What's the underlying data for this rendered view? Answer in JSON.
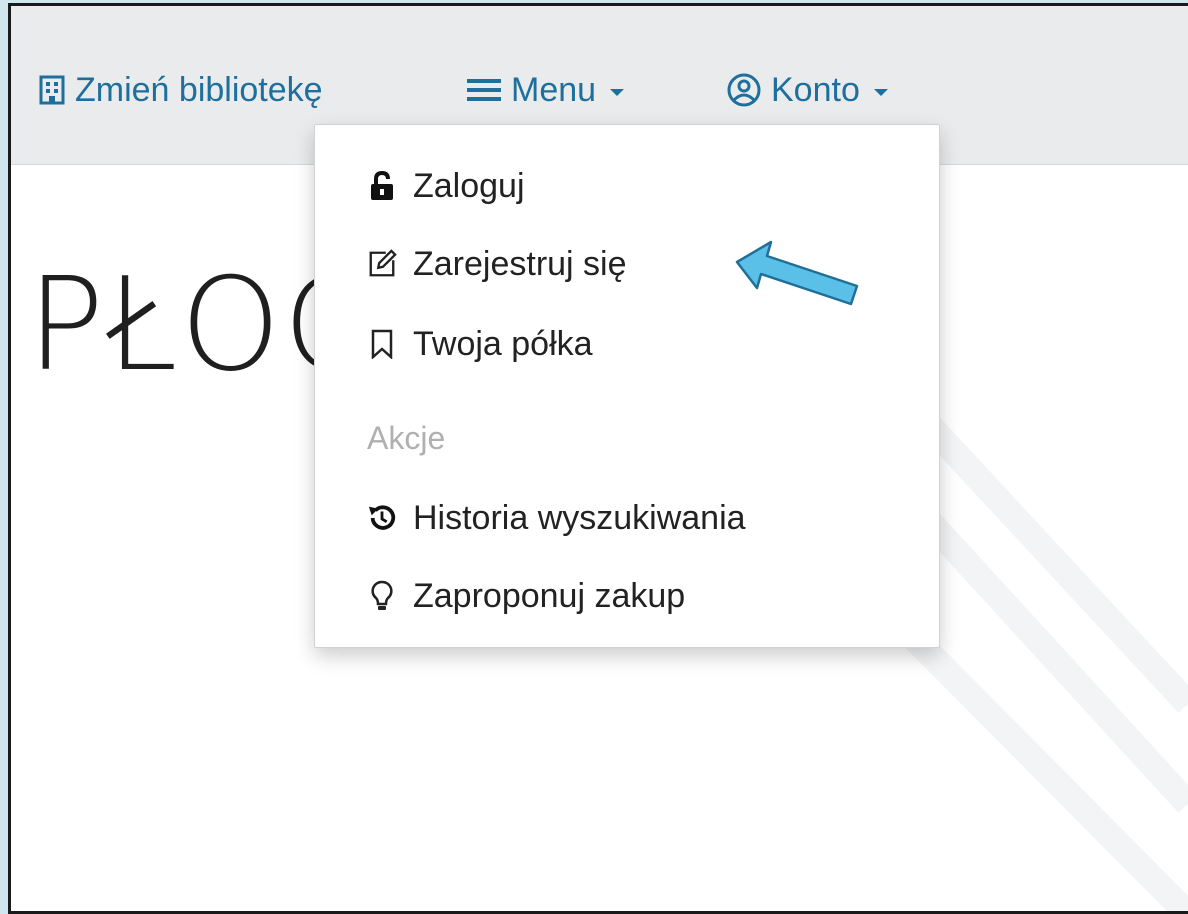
{
  "navbar": {
    "change_library": "Zmień bibliotekę",
    "menu": "Menu",
    "account": "Konto"
  },
  "page": {
    "title_fragment": "PŁOC"
  },
  "account_dropdown": {
    "items": [
      {
        "label": "Zaloguj",
        "icon": "unlock-icon"
      },
      {
        "label": "Zarejestruj się",
        "icon": "edit-icon"
      },
      {
        "label": "Twoja półka",
        "icon": "bookmark-icon"
      }
    ],
    "section_header": "Akcje",
    "actions": [
      {
        "label": "Historia wyszukiwania",
        "icon": "history-icon"
      },
      {
        "label": "Zaproponuj zakup",
        "icon": "lightbulb-icon"
      }
    ]
  },
  "colors": {
    "link": "#1e6f9c",
    "navbar_bg": "#e9ebec",
    "arrow_fill": "#5bc0e8",
    "outer_bg": "#cfe6ef"
  }
}
